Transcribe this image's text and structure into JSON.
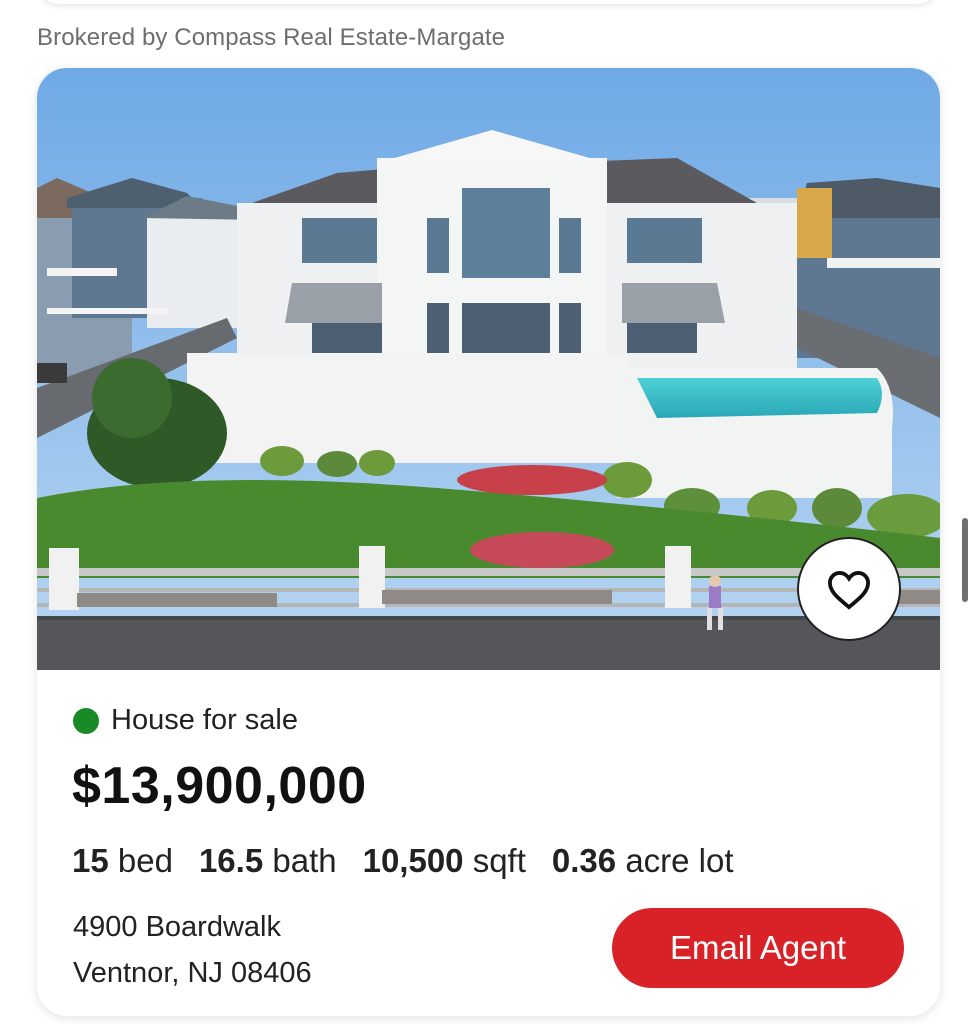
{
  "broker": {
    "text": "Brokered by Compass Real Estate-Margate"
  },
  "listing": {
    "status": "House for sale",
    "status_color": "#1a8a27",
    "price": "$13,900,000",
    "beds": "15",
    "beds_unit": "bed",
    "baths": "16.5",
    "baths_unit": "bath",
    "sqft": "10,500",
    "sqft_unit": "sqft",
    "lot": "0.36",
    "lot_unit": "acre lot",
    "address_line1": "4900 Boardwalk",
    "address_line2": "Ventnor, NJ 08406"
  },
  "actions": {
    "email_label": "Email Agent",
    "accent": "#d92228"
  },
  "icons": {
    "favorite": "heart-outline-icon"
  }
}
